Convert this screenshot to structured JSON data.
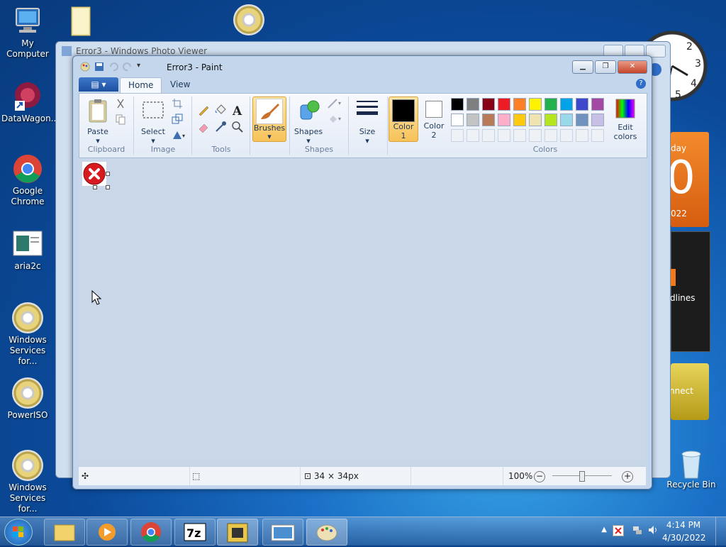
{
  "desktop_icons": [
    {
      "label": "My Computer",
      "icon": "computer-icon"
    },
    {
      "label": "",
      "icon": "folder-icon"
    },
    {
      "label": "",
      "icon": "disc-tool-icon"
    },
    {
      "label": "DataWagon...",
      "icon": "datawagon-icon"
    },
    {
      "label": "Google\nChrome",
      "icon": "chrome-icon"
    },
    {
      "label": "aria2c",
      "icon": "window-icon"
    },
    {
      "label": "Windows\nServices for...",
      "icon": "disc-icon"
    },
    {
      "label": "PowerISO",
      "icon": "disc-icon"
    },
    {
      "label": "Windows\nServices for...",
      "icon": "disc-icon"
    },
    {
      "label": "Recycle Bin",
      "icon": "recycle-bin-icon"
    }
  ],
  "gadgets": {
    "calendar_day": "day",
    "calendar_number": "0",
    "calendar_year": "022",
    "news_text": "dlines",
    "connect_text": "nnect"
  },
  "photo_viewer": {
    "title": "Error3 - Windows Photo Viewer"
  },
  "paint": {
    "title": "Error3 - Paint",
    "tabs": [
      "Home",
      "View"
    ],
    "groups": {
      "clipboard": "Clipboard",
      "image": "Image",
      "tools": "Tools",
      "shapes": "Shapes",
      "colors": "Colors"
    },
    "buttons": {
      "paste": "Paste",
      "select": "Select",
      "brushes": "Brushes",
      "shapes": "Shapes",
      "size": "Size",
      "color1": "Color\n1",
      "color2": "Color\n2",
      "edit_colors": "Edit\ncolors"
    },
    "palette_row1": [
      "#000000",
      "#7f7f7f",
      "#880015",
      "#ed1c24",
      "#ff7f27",
      "#fff200",
      "#22b14c",
      "#00a2e8",
      "#3f48cc",
      "#a349a4"
    ],
    "palette_row2": [
      "#ffffff",
      "#c3c3c3",
      "#b97a57",
      "#ffaec9",
      "#ffc90e",
      "#efe4b0",
      "#b5e61d",
      "#99d9ea",
      "#7092be",
      "#c8bfe7"
    ],
    "color1_value": "#000000",
    "color2_value": "#ffffff",
    "status": {
      "image_size": "34 × 34px",
      "zoom": "100%"
    }
  },
  "taskbar": {
    "time": "4:14 PM",
    "date": "4/30/2022",
    "apps": [
      "explorer-icon",
      "media-player-icon",
      "chrome-icon",
      "7zip-icon",
      "archive-icon",
      "photo-viewer-icon",
      "paint-icon"
    ]
  }
}
